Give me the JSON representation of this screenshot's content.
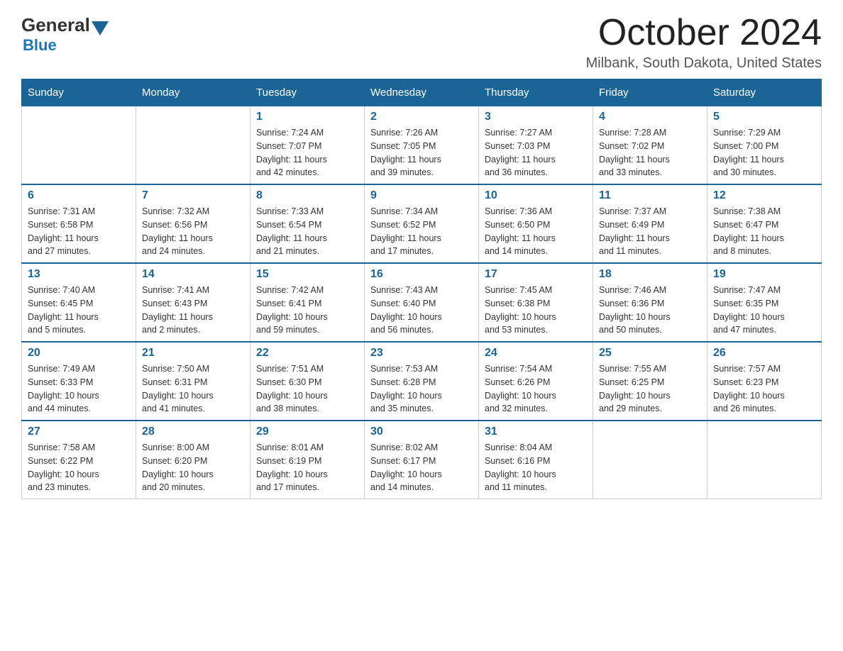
{
  "header": {
    "logo_general": "General",
    "logo_blue": "Blue",
    "month_year": "October 2024",
    "location": "Milbank, South Dakota, United States"
  },
  "days_of_week": [
    "Sunday",
    "Monday",
    "Tuesday",
    "Wednesday",
    "Thursday",
    "Friday",
    "Saturday"
  ],
  "weeks": [
    [
      {
        "day": "",
        "info": ""
      },
      {
        "day": "",
        "info": ""
      },
      {
        "day": "1",
        "info": "Sunrise: 7:24 AM\nSunset: 7:07 PM\nDaylight: 11 hours\nand 42 minutes."
      },
      {
        "day": "2",
        "info": "Sunrise: 7:26 AM\nSunset: 7:05 PM\nDaylight: 11 hours\nand 39 minutes."
      },
      {
        "day": "3",
        "info": "Sunrise: 7:27 AM\nSunset: 7:03 PM\nDaylight: 11 hours\nand 36 minutes."
      },
      {
        "day": "4",
        "info": "Sunrise: 7:28 AM\nSunset: 7:02 PM\nDaylight: 11 hours\nand 33 minutes."
      },
      {
        "day": "5",
        "info": "Sunrise: 7:29 AM\nSunset: 7:00 PM\nDaylight: 11 hours\nand 30 minutes."
      }
    ],
    [
      {
        "day": "6",
        "info": "Sunrise: 7:31 AM\nSunset: 6:58 PM\nDaylight: 11 hours\nand 27 minutes."
      },
      {
        "day": "7",
        "info": "Sunrise: 7:32 AM\nSunset: 6:56 PM\nDaylight: 11 hours\nand 24 minutes."
      },
      {
        "day": "8",
        "info": "Sunrise: 7:33 AM\nSunset: 6:54 PM\nDaylight: 11 hours\nand 21 minutes."
      },
      {
        "day": "9",
        "info": "Sunrise: 7:34 AM\nSunset: 6:52 PM\nDaylight: 11 hours\nand 17 minutes."
      },
      {
        "day": "10",
        "info": "Sunrise: 7:36 AM\nSunset: 6:50 PM\nDaylight: 11 hours\nand 14 minutes."
      },
      {
        "day": "11",
        "info": "Sunrise: 7:37 AM\nSunset: 6:49 PM\nDaylight: 11 hours\nand 11 minutes."
      },
      {
        "day": "12",
        "info": "Sunrise: 7:38 AM\nSunset: 6:47 PM\nDaylight: 11 hours\nand 8 minutes."
      }
    ],
    [
      {
        "day": "13",
        "info": "Sunrise: 7:40 AM\nSunset: 6:45 PM\nDaylight: 11 hours\nand 5 minutes."
      },
      {
        "day": "14",
        "info": "Sunrise: 7:41 AM\nSunset: 6:43 PM\nDaylight: 11 hours\nand 2 minutes."
      },
      {
        "day": "15",
        "info": "Sunrise: 7:42 AM\nSunset: 6:41 PM\nDaylight: 10 hours\nand 59 minutes."
      },
      {
        "day": "16",
        "info": "Sunrise: 7:43 AM\nSunset: 6:40 PM\nDaylight: 10 hours\nand 56 minutes."
      },
      {
        "day": "17",
        "info": "Sunrise: 7:45 AM\nSunset: 6:38 PM\nDaylight: 10 hours\nand 53 minutes."
      },
      {
        "day": "18",
        "info": "Sunrise: 7:46 AM\nSunset: 6:36 PM\nDaylight: 10 hours\nand 50 minutes."
      },
      {
        "day": "19",
        "info": "Sunrise: 7:47 AM\nSunset: 6:35 PM\nDaylight: 10 hours\nand 47 minutes."
      }
    ],
    [
      {
        "day": "20",
        "info": "Sunrise: 7:49 AM\nSunset: 6:33 PM\nDaylight: 10 hours\nand 44 minutes."
      },
      {
        "day": "21",
        "info": "Sunrise: 7:50 AM\nSunset: 6:31 PM\nDaylight: 10 hours\nand 41 minutes."
      },
      {
        "day": "22",
        "info": "Sunrise: 7:51 AM\nSunset: 6:30 PM\nDaylight: 10 hours\nand 38 minutes."
      },
      {
        "day": "23",
        "info": "Sunrise: 7:53 AM\nSunset: 6:28 PM\nDaylight: 10 hours\nand 35 minutes."
      },
      {
        "day": "24",
        "info": "Sunrise: 7:54 AM\nSunset: 6:26 PM\nDaylight: 10 hours\nand 32 minutes."
      },
      {
        "day": "25",
        "info": "Sunrise: 7:55 AM\nSunset: 6:25 PM\nDaylight: 10 hours\nand 29 minutes."
      },
      {
        "day": "26",
        "info": "Sunrise: 7:57 AM\nSunset: 6:23 PM\nDaylight: 10 hours\nand 26 minutes."
      }
    ],
    [
      {
        "day": "27",
        "info": "Sunrise: 7:58 AM\nSunset: 6:22 PM\nDaylight: 10 hours\nand 23 minutes."
      },
      {
        "day": "28",
        "info": "Sunrise: 8:00 AM\nSunset: 6:20 PM\nDaylight: 10 hours\nand 20 minutes."
      },
      {
        "day": "29",
        "info": "Sunrise: 8:01 AM\nSunset: 6:19 PM\nDaylight: 10 hours\nand 17 minutes."
      },
      {
        "day": "30",
        "info": "Sunrise: 8:02 AM\nSunset: 6:17 PM\nDaylight: 10 hours\nand 14 minutes."
      },
      {
        "day": "31",
        "info": "Sunrise: 8:04 AM\nSunset: 6:16 PM\nDaylight: 10 hours\nand 11 minutes."
      },
      {
        "day": "",
        "info": ""
      },
      {
        "day": "",
        "info": ""
      }
    ]
  ]
}
